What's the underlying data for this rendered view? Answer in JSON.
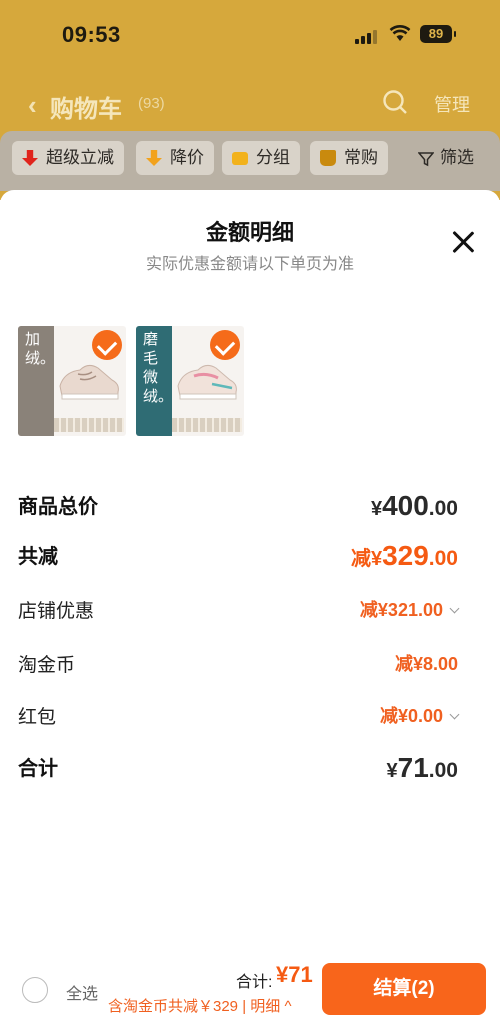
{
  "status_bar": {
    "time": "09:53",
    "battery": "89"
  },
  "nav": {
    "back_icon": "chevron-left-icon",
    "title": "购物车",
    "count": "(93)",
    "manage": "管理"
  },
  "filters": [
    {
      "label": "超级立减",
      "icon": "arrow-down-icon",
      "color": "#e0241c"
    },
    {
      "label": "降价",
      "icon": "arrow-down-icon",
      "color": "#f2a21c"
    },
    {
      "label": "分组",
      "icon": "folder-icon",
      "color": "#f2b21c"
    },
    {
      "label": "常购",
      "icon": "cart-icon",
      "color": "#c98a0e"
    },
    {
      "label": "筛选",
      "icon": "filter-icon"
    }
  ],
  "sheet": {
    "title": "金额明细",
    "subtitle": "实际优惠金额请以下单页为准",
    "products": [
      {
        "tag": "加绒。",
        "band_color": "#8a8279"
      },
      {
        "tag": "磨毛微绒。",
        "band_color": "#2f6c74"
      }
    ],
    "rows": {
      "goods_total": {
        "label": "商品总价",
        "cur": "¥",
        "int": "400",
        "dec": ".00"
      },
      "total_reduce": {
        "label": "共减",
        "prefix": "减",
        "cur": "¥",
        "int": "329",
        "dec": ".00"
      },
      "shop_discount": {
        "label": "店铺优惠",
        "value": "减¥321.00"
      },
      "taojinbi": {
        "label": "淘金币",
        "value": "减¥8.00"
      },
      "red_packet": {
        "label": "红包",
        "value": "减¥0.00"
      },
      "sum": {
        "label": "合计",
        "cur": "¥",
        "int": "71",
        "dec": ".00"
      }
    }
  },
  "bottom": {
    "select_all": "全选",
    "total_label": "合计:",
    "total_amount": "¥71",
    "note": "含淘金币共减￥329 | 明细",
    "checkout": "结算(2)"
  },
  "colors": {
    "accent": "#f8651b",
    "discount": "#f55a12"
  }
}
